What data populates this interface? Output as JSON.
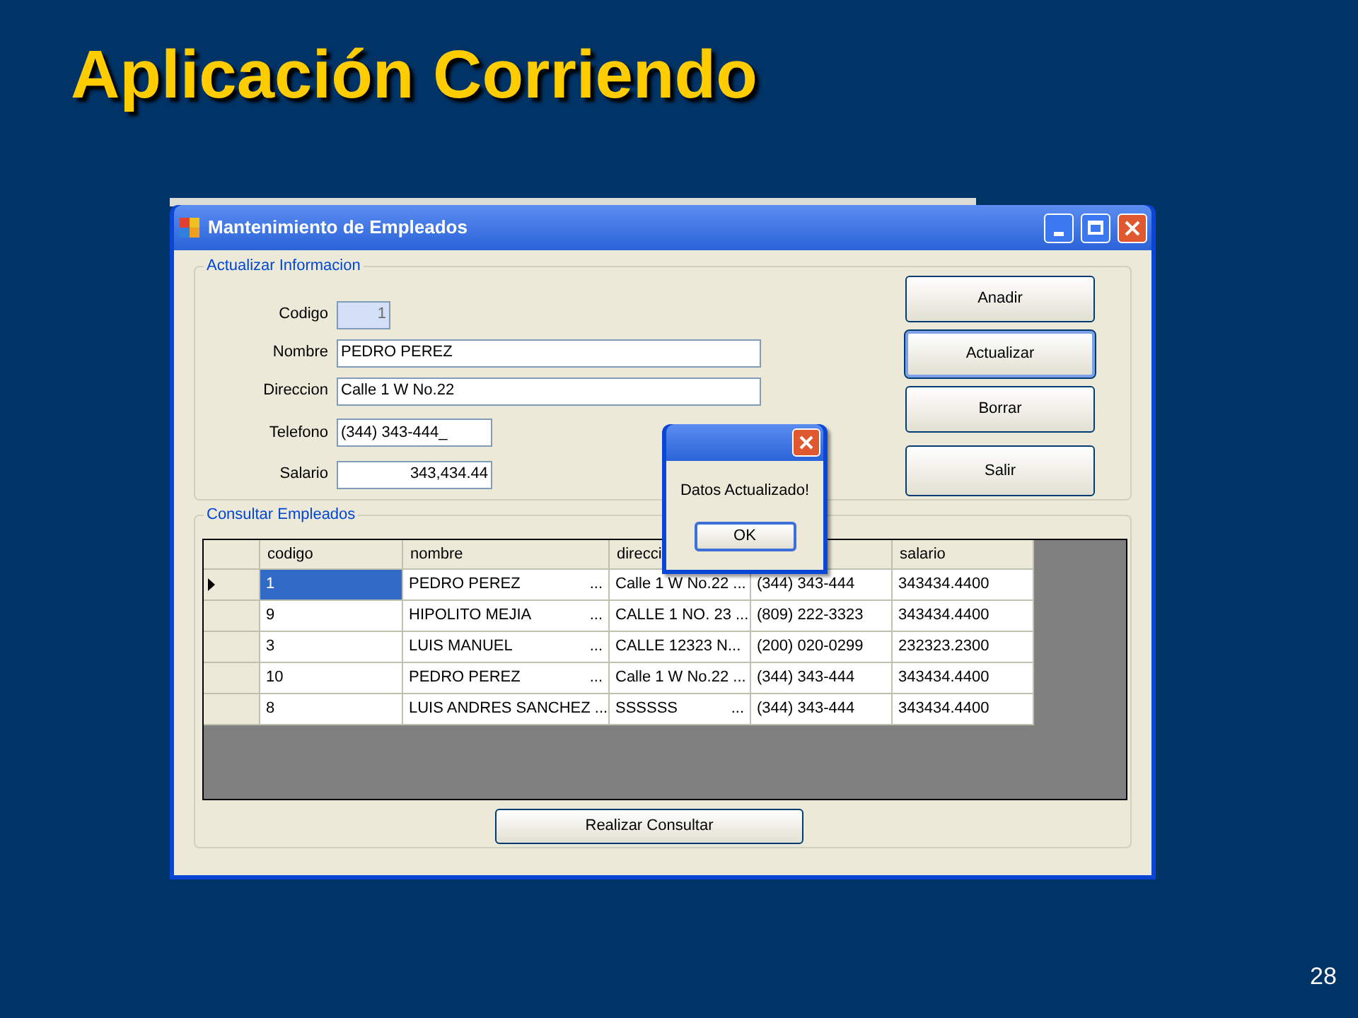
{
  "slide": {
    "title": "Aplicación Corriendo",
    "page_number": "28"
  },
  "window": {
    "title": "Mantenimiento de Empleados"
  },
  "update_group": {
    "title": "Actualizar Informacion",
    "fields": [
      {
        "label": "Codigo",
        "value": "1",
        "disabled": true
      },
      {
        "label": "Nombre",
        "value": "PEDRO PEREZ",
        "disabled": false
      },
      {
        "label": "Direccion",
        "value": "Calle 1 W No.22",
        "disabled": false
      },
      {
        "label": "Telefono",
        "value": "(344) 343-444_",
        "disabled": false
      },
      {
        "label": "Salario",
        "value": "343,434.44",
        "disabled": false
      }
    ],
    "buttons": [
      {
        "label": "Anadir",
        "focused": false
      },
      {
        "label": "Actualizar",
        "focused": true
      },
      {
        "label": "Borrar",
        "focused": false
      },
      {
        "label": "Salir",
        "focused": false
      }
    ]
  },
  "query_group": {
    "title": "Consultar Empleados",
    "columns": [
      "codigo",
      "nombre",
      "direcci",
      "",
      "salario"
    ],
    "rows": [
      {
        "selected": true,
        "cells": [
          {
            "text": "1"
          },
          {
            "text": "PEDRO PEREZ",
            "more": "..."
          },
          {
            "text": "Calle 1 W No.22 ..."
          },
          {
            "text": "(344) 343-444"
          },
          {
            "text": "343434.4400"
          }
        ]
      },
      {
        "selected": false,
        "cells": [
          {
            "text": "9"
          },
          {
            "text": "HIPOLITO MEJIA",
            "more": "..."
          },
          {
            "text": "CALLE 1 NO. 23 ..."
          },
          {
            "text": "(809) 222-3323"
          },
          {
            "text": "343434.4400"
          }
        ]
      },
      {
        "selected": false,
        "cells": [
          {
            "text": "3"
          },
          {
            "text": "LUIS MANUEL",
            "more": "..."
          },
          {
            "text": "CALLE 12323 N..."
          },
          {
            "text": "(200) 020-0299"
          },
          {
            "text": "232323.2300"
          }
        ]
      },
      {
        "selected": false,
        "cells": [
          {
            "text": "10"
          },
          {
            "text": "PEDRO PEREZ",
            "more": "..."
          },
          {
            "text": "Calle 1 W No.22 ..."
          },
          {
            "text": "(344) 343-444"
          },
          {
            "text": "343434.4400"
          }
        ]
      },
      {
        "selected": false,
        "cells": [
          {
            "text": "8"
          },
          {
            "text": "LUIS ANDRES SANCHEZ ..."
          },
          {
            "text": "SSSSSS",
            "more": "..."
          },
          {
            "text": "(344) 343-444"
          },
          {
            "text": "343434.4400"
          }
        ]
      }
    ],
    "button": "Realizar Consultar"
  },
  "dialog": {
    "message": "Datos Actualizado!",
    "button": "OK"
  }
}
